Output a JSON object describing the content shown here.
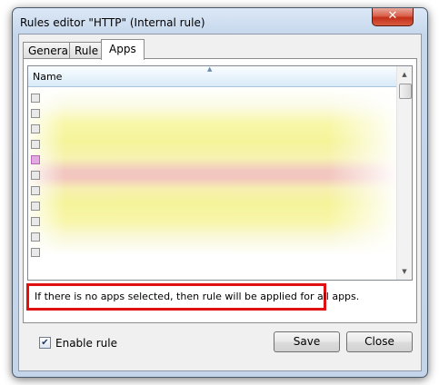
{
  "window": {
    "title": "Rules editor \"HTTP\" (Internal rule)",
    "close_glyph": "✕"
  },
  "tabs": [
    {
      "label": "General",
      "active": false
    },
    {
      "label": "Rule",
      "active": false
    },
    {
      "label": "Apps",
      "active": true
    }
  ],
  "apps_list": {
    "column_header": "Name",
    "sort_glyph": "▲",
    "scroll_up_glyph": "▲",
    "scroll_down_glyph": "▼"
  },
  "hint": "If there is no apps selected, then rule will be applied for all apps.",
  "enable_rule": {
    "label": "Enable rule",
    "checked": true,
    "check_glyph": "✔"
  },
  "buttons": {
    "save": "Save",
    "close": "Close"
  },
  "colors": {
    "highlight_border": "#e01010",
    "close_button": "#c4301a"
  }
}
